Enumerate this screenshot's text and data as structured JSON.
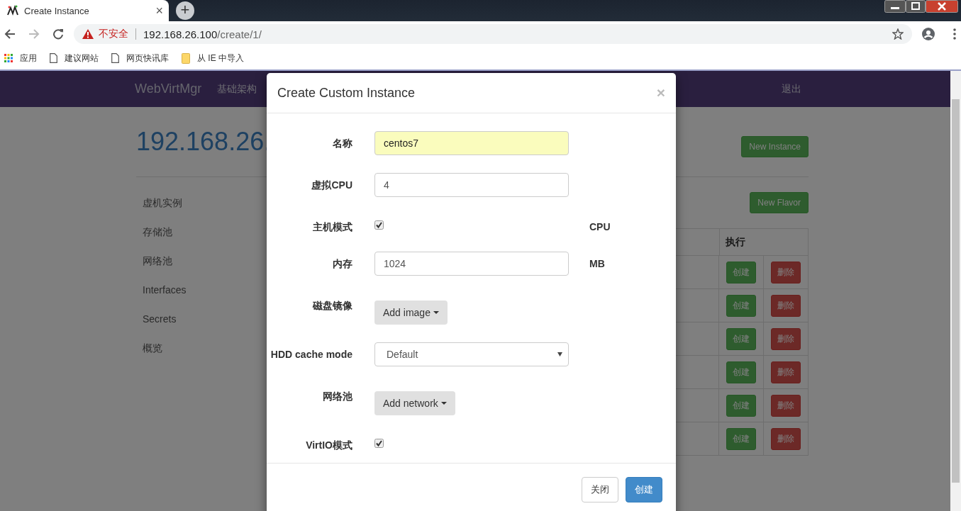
{
  "browser": {
    "tab_title": "Create Instance",
    "tab_close": "×",
    "new_tab": "+",
    "security": "不安全",
    "host": "192.168.26.100",
    "path": "/create/1/",
    "bookmarks": [
      {
        "kind": "apps",
        "label": "应用"
      },
      {
        "kind": "page",
        "label": "建议网站"
      },
      {
        "kind": "page",
        "label": "网页快讯库"
      },
      {
        "kind": "folder",
        "label": "从 IE 中导入"
      }
    ]
  },
  "navbar": {
    "brand": "WebVirtMgr",
    "items": [
      "基础架构"
    ],
    "logout": "退出"
  },
  "page": {
    "title": "192.168.26.",
    "new_instance": "New Instance",
    "sidebar": [
      "虚机实例",
      "存储池",
      "网络池",
      "Interfaces",
      "Secrets",
      "概览"
    ],
    "new_flavor": "New Flavor",
    "table_header": "执行",
    "rows": [
      {
        "create": "创建",
        "delete": "删除"
      },
      {
        "create": "创建",
        "delete": "删除"
      },
      {
        "create": "创建",
        "delete": "删除"
      },
      {
        "create": "创建",
        "delete": "删除"
      },
      {
        "create": "创建",
        "delete": "删除"
      },
      {
        "create": "创建",
        "delete": "删除"
      }
    ]
  },
  "modal": {
    "title": "Create Custom Instance",
    "close": "×",
    "fields": [
      {
        "kind": "input",
        "label": "名称",
        "value": "centos7",
        "autofilled": true
      },
      {
        "kind": "input",
        "label": "虚拟CPU",
        "value": "4",
        "autofilled": false
      },
      {
        "kind": "checkbox",
        "label": "主机模式",
        "checked": true,
        "unit": "CPU"
      },
      {
        "kind": "input",
        "label": "内存",
        "value": "1024",
        "autofilled": false,
        "unit": "MB"
      },
      {
        "kind": "dropdown_button",
        "label": "磁盘镜像",
        "button": "Add image"
      },
      {
        "kind": "select",
        "label": "HDD cache mode",
        "value": "Default"
      },
      {
        "kind": "dropdown_button",
        "label": "网络池",
        "button": "Add network"
      },
      {
        "kind": "checkbox",
        "label": "VirtIO模式",
        "checked": true
      }
    ],
    "buttons": [
      {
        "kind": "default",
        "label": "关闭"
      },
      {
        "kind": "primary",
        "label": "创建"
      }
    ]
  }
}
